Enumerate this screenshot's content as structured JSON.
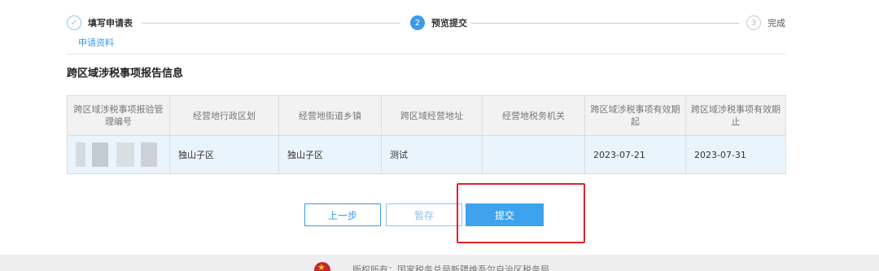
{
  "steps": [
    {
      "index": "✓",
      "label": "填写申请表",
      "state": "done"
    },
    {
      "index": "2",
      "label": "预览提交",
      "state": "active"
    },
    {
      "index": "3",
      "label": "完成",
      "state": "todo"
    }
  ],
  "subtab": {
    "label": "申请资料"
  },
  "section": {
    "title": "跨区域涉税事项报告信息"
  },
  "table": {
    "headers": [
      "跨区域涉税事项报验管理编号",
      "经营地行政区划",
      "经营地街道乡镇",
      "跨区域经营地址",
      "经营地税务机关",
      "跨区域涉税事项有效期起",
      "跨区域涉税事项有效期止"
    ],
    "row": {
      "c2": "独山子区",
      "c3": "独山子区",
      "c4": "测试",
      "c5": "",
      "c6": "2023-07-21",
      "c7": "2023-07-31"
    }
  },
  "buttons": {
    "prev": "上一步",
    "save": "暂存",
    "submit": "提交"
  },
  "footer": {
    "text": "版权所有：国家税务总局新疆维吾尔自治区税务局"
  },
  "colors": {
    "accent": "#3b9ae8",
    "highlight": "#e0242c",
    "row_bg": "#eaf4fc"
  }
}
